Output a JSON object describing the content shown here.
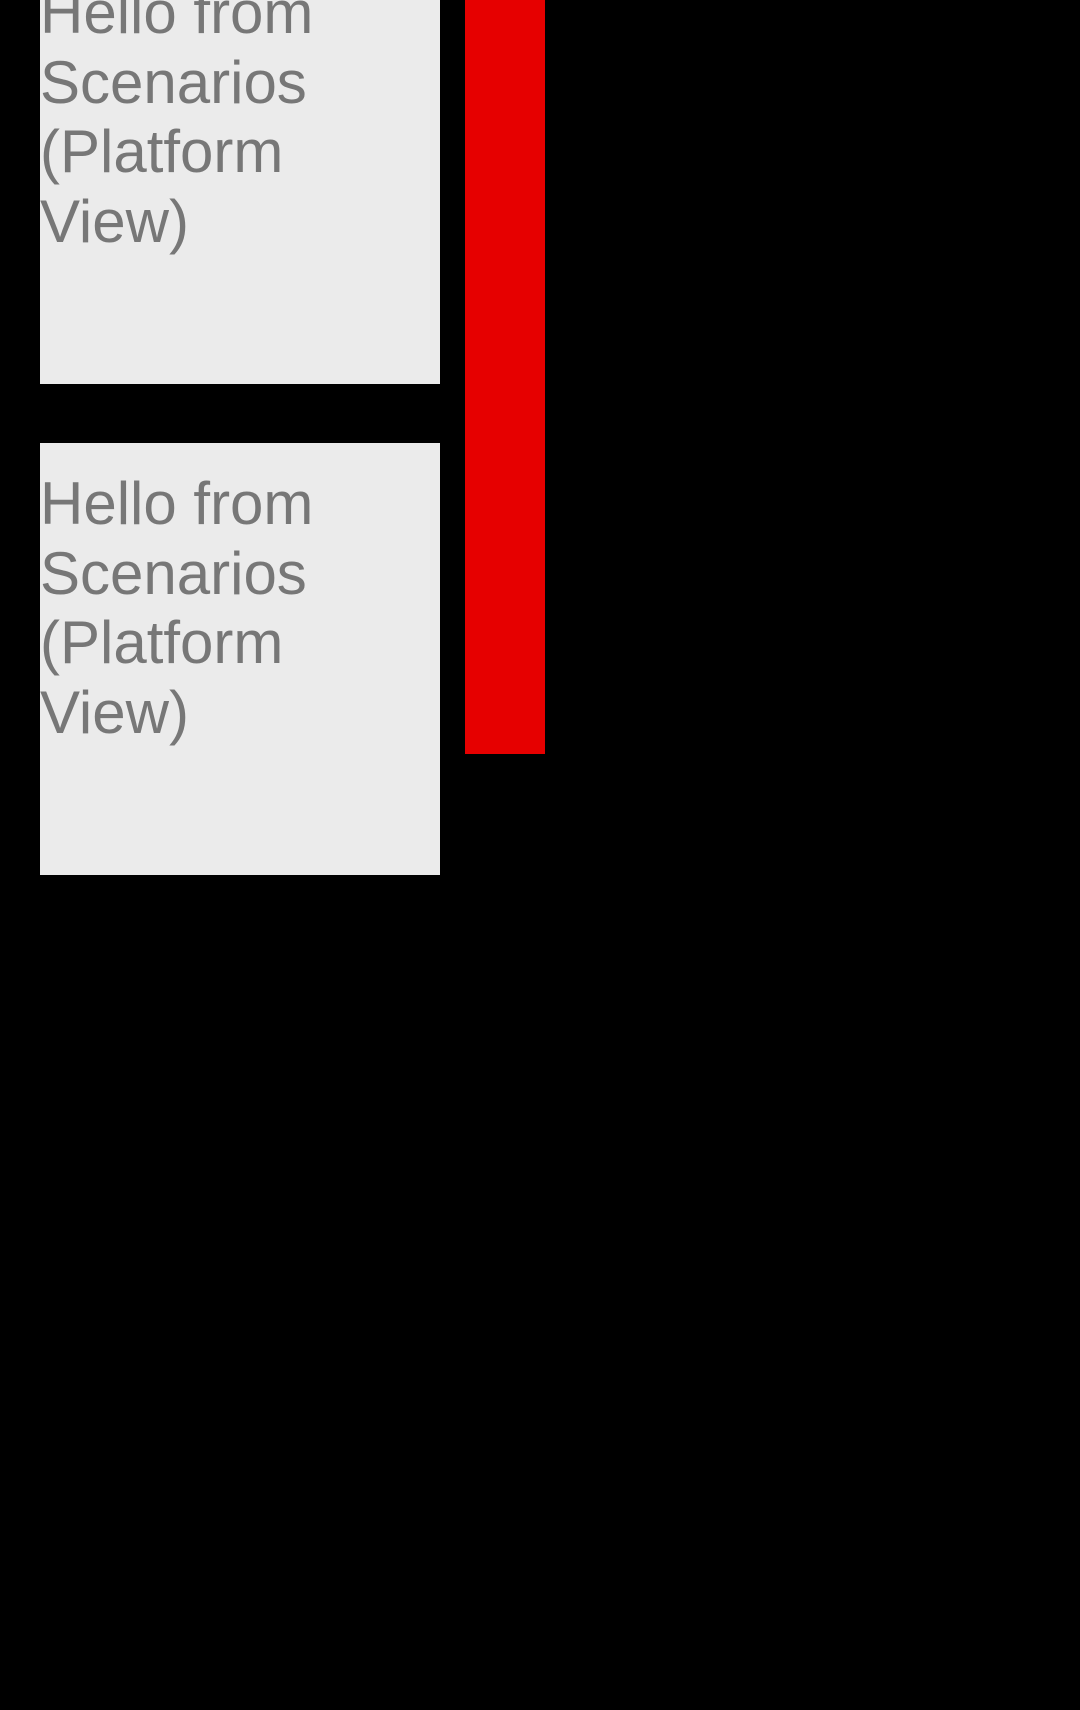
{
  "platform_views": [
    {
      "text": "Hello from Scenarios (Platform View)"
    },
    {
      "text": "Hello from Scenarios (Platform View)"
    }
  ],
  "colors": {
    "background": "#000000",
    "card_background": "#ebebeb",
    "text": "#777777",
    "accent_bar": "#e60000"
  }
}
